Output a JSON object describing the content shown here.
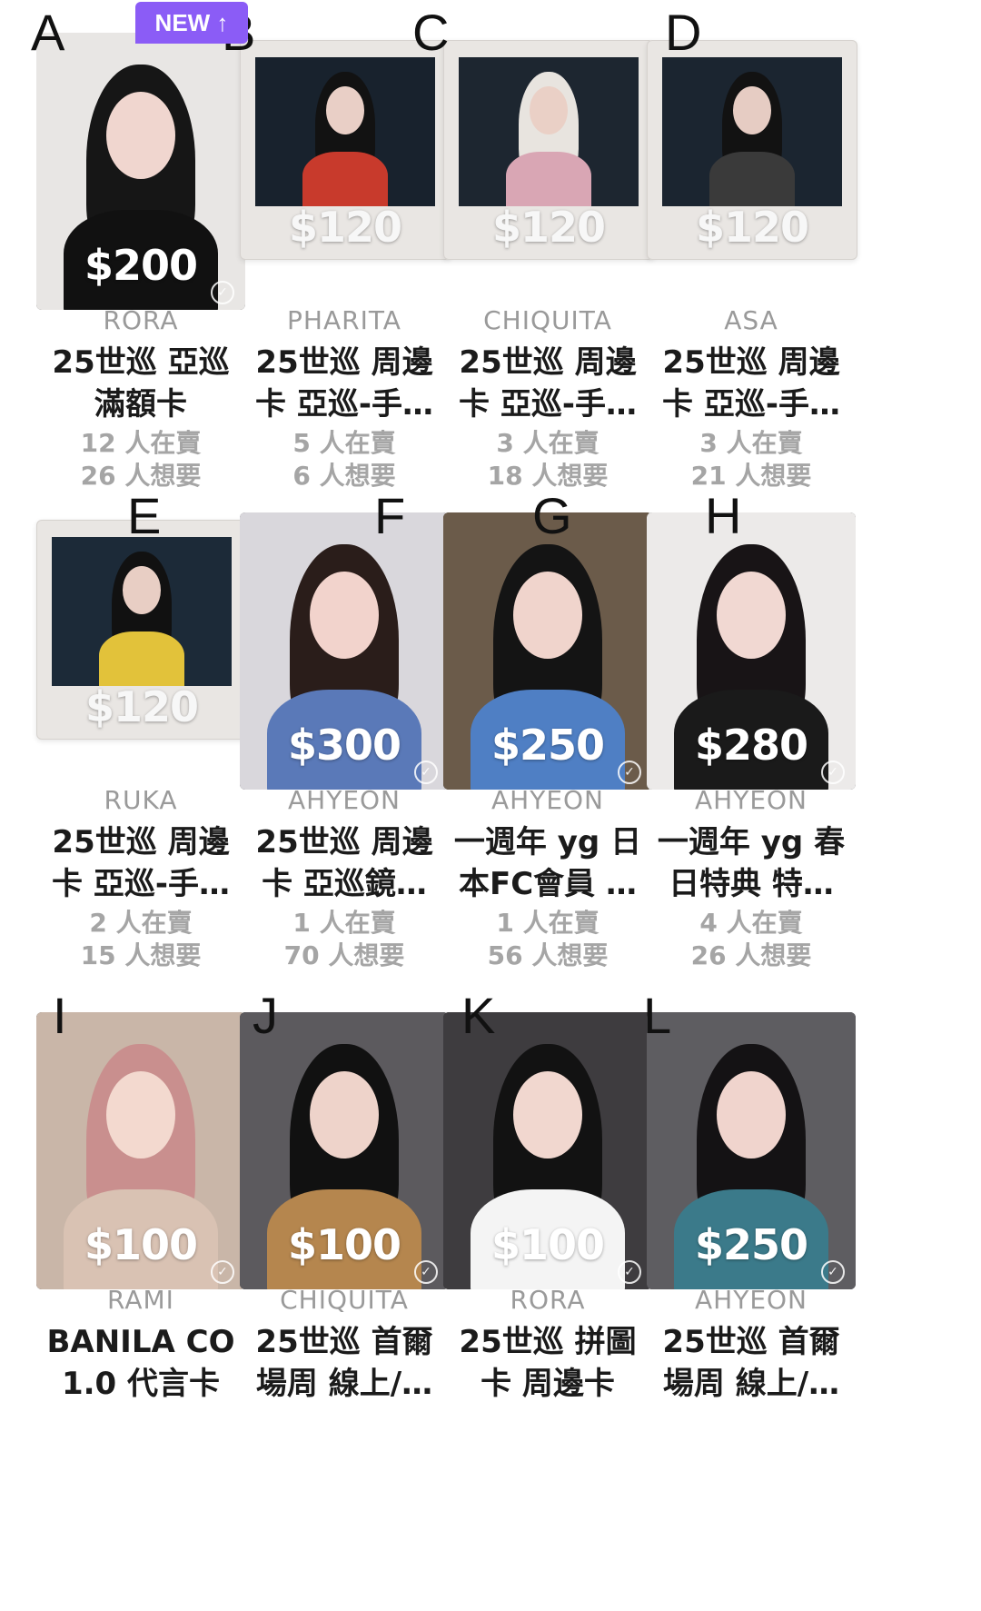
{
  "badge": {
    "new_label": "NEW ↑"
  },
  "check_glyph": "✓",
  "cards": [
    {
      "letter": "A",
      "name": "RORA",
      "title_l1": "25世巡 亞巡",
      "title_l2": "滿額卡",
      "selling": "12 人在賣",
      "wanting": "26 人想要",
      "price": "$200",
      "style": "photo",
      "bg": "#e8e6e4",
      "hair": "#161616",
      "skin": "#f0d6cf",
      "top": "#111111"
    },
    {
      "letter": "B",
      "name": "PHARITA",
      "title_l1": "25世巡 周邊",
      "title_l2": "卡 亞巡-手…",
      "selling": "5 人在賣",
      "wanting": "6 人想要",
      "price": "$120",
      "style": "polaroid",
      "bg": "#18222d",
      "hair": "#121212",
      "skin": "#e9cfc6",
      "top": "#c83a2c"
    },
    {
      "letter": "C",
      "name": "CHIQUITA",
      "title_l1": "25世巡 周邊",
      "title_l2": "卡 亞巡-手…",
      "selling": "3 人在賣",
      "wanting": "18 人想要",
      "price": "$120",
      "style": "polaroid",
      "bg": "#1d2630",
      "hair": "#e8e4df",
      "skin": "#ead0c6",
      "top": "#d9a6b4"
    },
    {
      "letter": "D",
      "name": "ASA",
      "title_l1": "25世巡 周邊",
      "title_l2": "卡 亞巡-手…",
      "selling": "3 人在賣",
      "wanting": "21 人想要",
      "price": "$120",
      "style": "polaroid",
      "bg": "#1b2530",
      "hair": "#121212",
      "skin": "#e6ccc3",
      "top": "#3a3a3a"
    },
    {
      "letter": "E",
      "name": "RUKA",
      "title_l1": "25世巡 周邊",
      "title_l2": "卡 亞巡-手…",
      "selling": "2 人在賣",
      "wanting": "15 人想要",
      "price": "$120",
      "style": "polaroid",
      "bg": "#1c2a38",
      "hair": "#111111",
      "skin": "#e8cec4",
      "top": "#e2c23a"
    },
    {
      "letter": "F",
      "name": "AHYEON",
      "title_l1": "25世巡 周邊",
      "title_l2": "卡 亞巡鏡…",
      "selling": "1 人在賣",
      "wanting": "70 人想要",
      "price": "$300",
      "style": "photo",
      "bg": "#d9d7dc",
      "hair": "#2a1d1a",
      "skin": "#f2d3cc",
      "top": "#5a79b8"
    },
    {
      "letter": "G",
      "name": "AHYEON",
      "title_l1": "一週年 yg 日",
      "title_l2": "本FC會員 …",
      "selling": "1 人在賣",
      "wanting": "56 人想要",
      "price": "$250",
      "style": "photo",
      "bg": "#6b5b4a",
      "hair": "#141414",
      "skin": "#f0d4cc",
      "top": "#4f7fc4"
    },
    {
      "letter": "H",
      "name": "AHYEON",
      "title_l1": "一週年 yg 春",
      "title_l2": "日特典 特…",
      "selling": "4 人在賣",
      "wanting": "26 人想要",
      "price": "$280",
      "style": "photo",
      "bg": "#eceae9",
      "hair": "#181416",
      "skin": "#f1d8d2",
      "top": "#1a1a1a"
    },
    {
      "letter": "I",
      "name": "RAMI",
      "title_l1": "BANILA CO",
      "title_l2": "1.0 代言卡",
      "selling": "",
      "wanting": "",
      "price": "$100",
      "style": "photo",
      "bg": "#c9b6a8",
      "hair": "#c98f8e",
      "skin": "#f3d9cf",
      "top": "#d9c2b3"
    },
    {
      "letter": "J",
      "name": "CHIQUITA",
      "title_l1": "25世巡 首爾",
      "title_l2": "場周 線上/…",
      "selling": "",
      "wanting": "",
      "price": "$100",
      "style": "photo",
      "bg": "#5c5a5e",
      "hair": "#111111",
      "skin": "#eed3ca",
      "top": "#b5864e"
    },
    {
      "letter": "K",
      "name": "RORA",
      "title_l1": "25世巡 拼圖",
      "title_l2": "卡 周邊卡",
      "selling": "",
      "wanting": "",
      "price": "$100",
      "style": "photo",
      "bg": "#3e3c3f",
      "hair": "#121212",
      "skin": "#f1d7cf",
      "top": "#f4f4f4"
    },
    {
      "letter": "L",
      "name": "AHYEON",
      "title_l1": "25世巡 首爾",
      "title_l2": "場周 線上/…",
      "selling": "",
      "wanting": "",
      "price": "$250",
      "style": "photo",
      "bg": "#5e5d61",
      "hair": "#141214",
      "skin": "#f0d4cd",
      "top": "#3b7a8a"
    }
  ]
}
